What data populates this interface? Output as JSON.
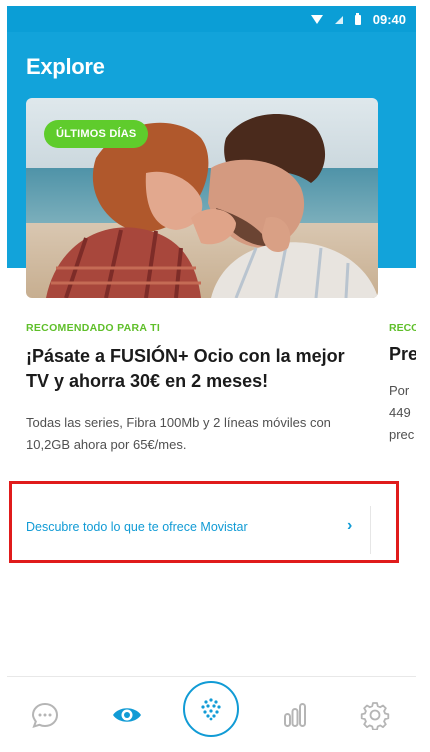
{
  "status_bar": {
    "time": "09:40"
  },
  "header": {
    "title": "Explore"
  },
  "card": {
    "badge": "ÚLTIMOS DÍAS",
    "eyebrow": "RECOMENDADO PARA TI",
    "headline": "¡Pásate a FUSIÓN+ Ocio con la mejor TV y ahorra 30€ en 2 meses!",
    "description": "Todas las series, Fibra 100Mb y 2 líneas móviles con 10,2GB ahora por 65€/mes."
  },
  "next_card": {
    "eyebrow": "RECO",
    "headline": "Pre",
    "description": "Por 449 prec"
  },
  "link": {
    "label": "Descubre todo lo que te ofrece Movistar",
    "chevron": "›"
  },
  "tabbar": {
    "tabs": [
      {
        "icon": "chat-icon",
        "active": false
      },
      {
        "icon": "eye-icon",
        "active": true
      },
      {
        "icon": "movistar-logo-icon",
        "active": false
      },
      {
        "icon": "bar-chart-icon",
        "active": false
      },
      {
        "icon": "gear-icon",
        "active": false
      }
    ]
  },
  "colors": {
    "header": "#12a3da",
    "accent": "#119bd5",
    "green": "#5fcc2c",
    "highlight": "#e01b1b"
  }
}
